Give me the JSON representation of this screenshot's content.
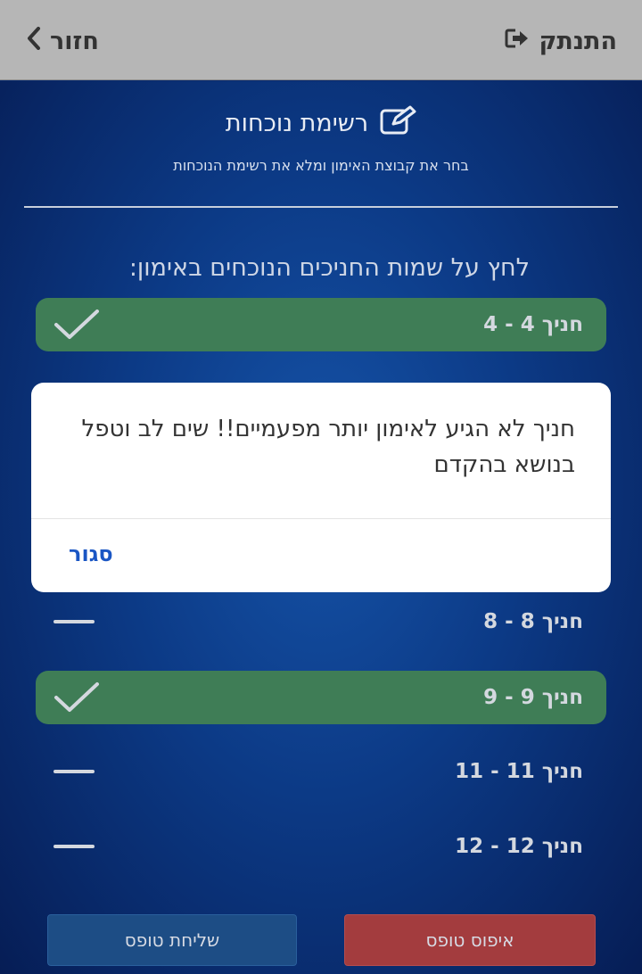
{
  "topbar": {
    "logout_label": "התנתק",
    "logout_icon": "sign-out-icon",
    "back_label": "חזור",
    "back_icon": "chevron-left-icon"
  },
  "header": {
    "title": "רשימת נוכחות",
    "title_icon": "edit-icon",
    "subtitle": "בחר את קבוצת האימון ומלא את רשימת הנוכחות"
  },
  "instruction": "לחץ על שמות החניכים הנוכחים באימון:",
  "trainees": [
    {
      "label": "חניך 4 - 4",
      "selected": true
    },
    {
      "label": "חניך 8 - 8",
      "selected": false
    },
    {
      "label": "חניך 9 - 9",
      "selected": true
    },
    {
      "label": "חניך 11 - 11",
      "selected": false
    },
    {
      "label": "חניך 12 - 12",
      "selected": false
    }
  ],
  "dialog": {
    "message": "חניך לא הגיע לאימון יותר מפעמיים!! שים לב וטפל בנושא בהקדם",
    "close_label": "סגור"
  },
  "buttons": {
    "reset_label": "איפוס טופס",
    "send_label": "שליחת טופס"
  },
  "colors": {
    "topbar": "#b6b6b6",
    "selected_row": "#3f7d56",
    "reset_button": "#a33c3e",
    "send_button": "#1d4d85",
    "dialog_link": "#1a56c4"
  }
}
